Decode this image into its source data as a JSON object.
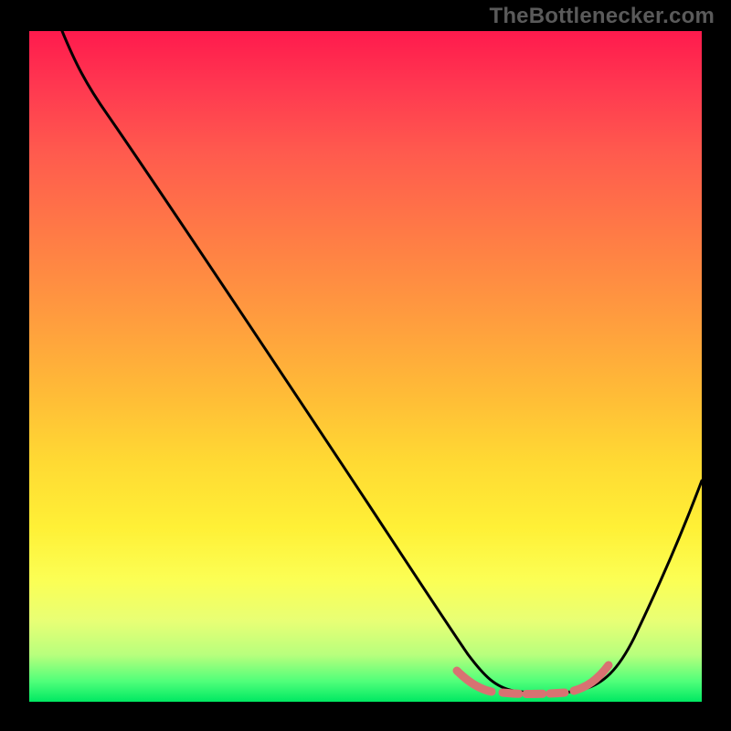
{
  "watermark": "TheBottlenecker.com",
  "chart_data": {
    "type": "line",
    "title": "",
    "xlabel": "",
    "ylabel": "",
    "xlim": [
      0,
      100
    ],
    "ylim": [
      0,
      100
    ],
    "note": "Axis values are estimated from position only; no tick labels are visible. y=100 at top, y=0 at bottom.",
    "series": [
      {
        "name": "curve",
        "x": [
          5,
          8,
          12,
          20,
          30,
          40,
          50,
          58,
          64,
          68,
          72,
          76,
          80,
          84,
          88,
          92,
          96,
          100
        ],
        "y": [
          100,
          96,
          91,
          79,
          64,
          49,
          34,
          22,
          13,
          7.5,
          4,
          2.5,
          2,
          2.5,
          4,
          10,
          20,
          34
        ]
      },
      {
        "name": "highlight-band",
        "x": [
          64,
          84
        ],
        "y": [
          3,
          3
        ]
      }
    ],
    "colors": {
      "curve": "#000000",
      "highlight": "#d46a6a",
      "background_top": "#ff1a4d",
      "background_bottom": "#00e862"
    }
  }
}
